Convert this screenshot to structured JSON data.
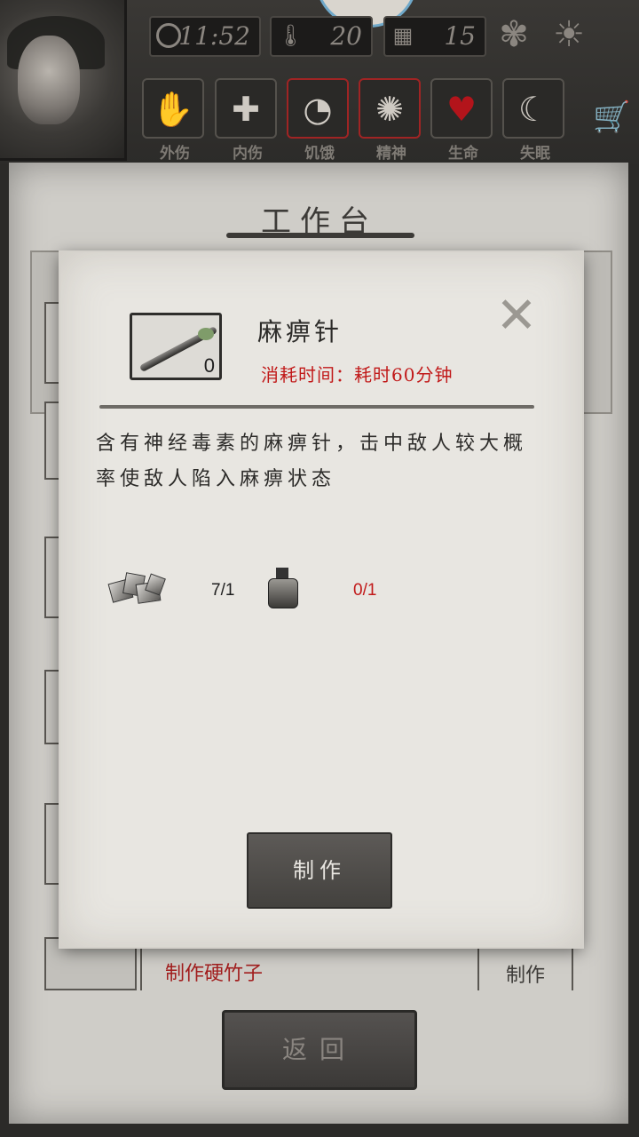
{
  "hud": {
    "time": "11:52",
    "temperature": "20",
    "day": "15",
    "icons": [
      "clock-icon",
      "thermometer-icon",
      "calendar-icon",
      "leaf-icon",
      "sun-icon",
      "cart-icon"
    ],
    "statuses": [
      {
        "label": "外伤",
        "glyph": "✋",
        "alert": false
      },
      {
        "label": "内伤",
        "glyph": "✚",
        "alert": false
      },
      {
        "label": "饥饿",
        "glyph": "◔",
        "alert": true
      },
      {
        "label": "精神",
        "glyph": "✺",
        "alert": true
      },
      {
        "label": "生命",
        "glyph": "♥",
        "alert": false
      },
      {
        "label": "失眠",
        "glyph": "☾",
        "alert": false
      }
    ]
  },
  "workbench": {
    "title": "工作台",
    "row_item_name": "制作硬竹子",
    "row_make_label": "制作",
    "back_label": "返回"
  },
  "modal": {
    "item_name": "麻痹针",
    "item_count": "0",
    "time_cost": "消耗时间：耗时60分钟",
    "description": "含有神经毒素的麻痹针，击中敌人较大概率使敌人陷入麻痹状态",
    "materials": [
      {
        "icon": "ore-icon",
        "qty": "7/1",
        "color": "#1e1e1e"
      },
      {
        "icon": "bottle-icon",
        "qty": "0/1",
        "color": "#c11919"
      }
    ],
    "make_label": "制作"
  }
}
